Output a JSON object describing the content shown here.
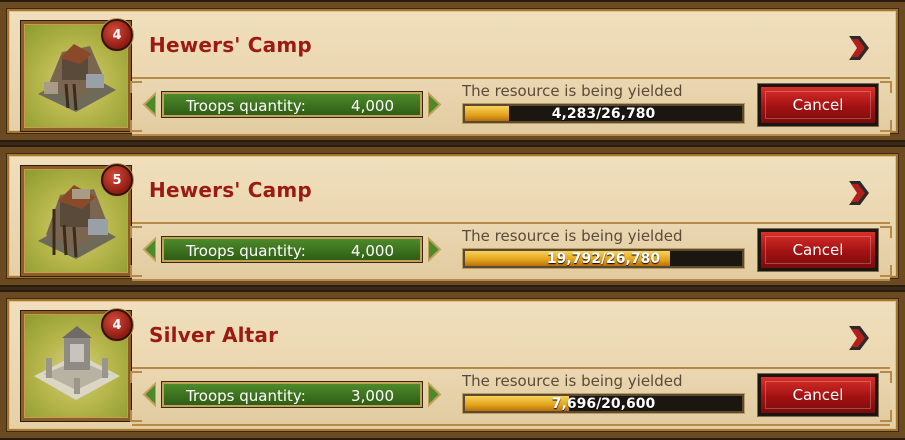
{
  "cards": [
    {
      "level": "4",
      "title": "Hewers' Camp",
      "troops_label": "Troops quantity:",
      "troops_value": "4,000",
      "status_text": "The resource is being yielded",
      "progress_text": "4,283/26,780",
      "progress_fraction": 0.16,
      "cancel_label": "Cancel",
      "icon": "hewers-camp-icon"
    },
    {
      "level": "5",
      "title": "Hewers' Camp",
      "troops_label": "Troops quantity:",
      "troops_value": "4,000",
      "status_text": "The resource is being yielded",
      "progress_text": "19,792/26,780",
      "progress_fraction": 0.739,
      "cancel_label": "Cancel",
      "icon": "hewers-camp-icon"
    },
    {
      "level": "4",
      "title": "Silver Altar",
      "troops_label": "Troops quantity:",
      "troops_value": "3,000",
      "status_text": "The resource is being yielded",
      "progress_text": "7,696/20,600",
      "progress_fraction": 0.374,
      "cancel_label": "Cancel",
      "icon": "silver-altar-icon"
    }
  ]
}
